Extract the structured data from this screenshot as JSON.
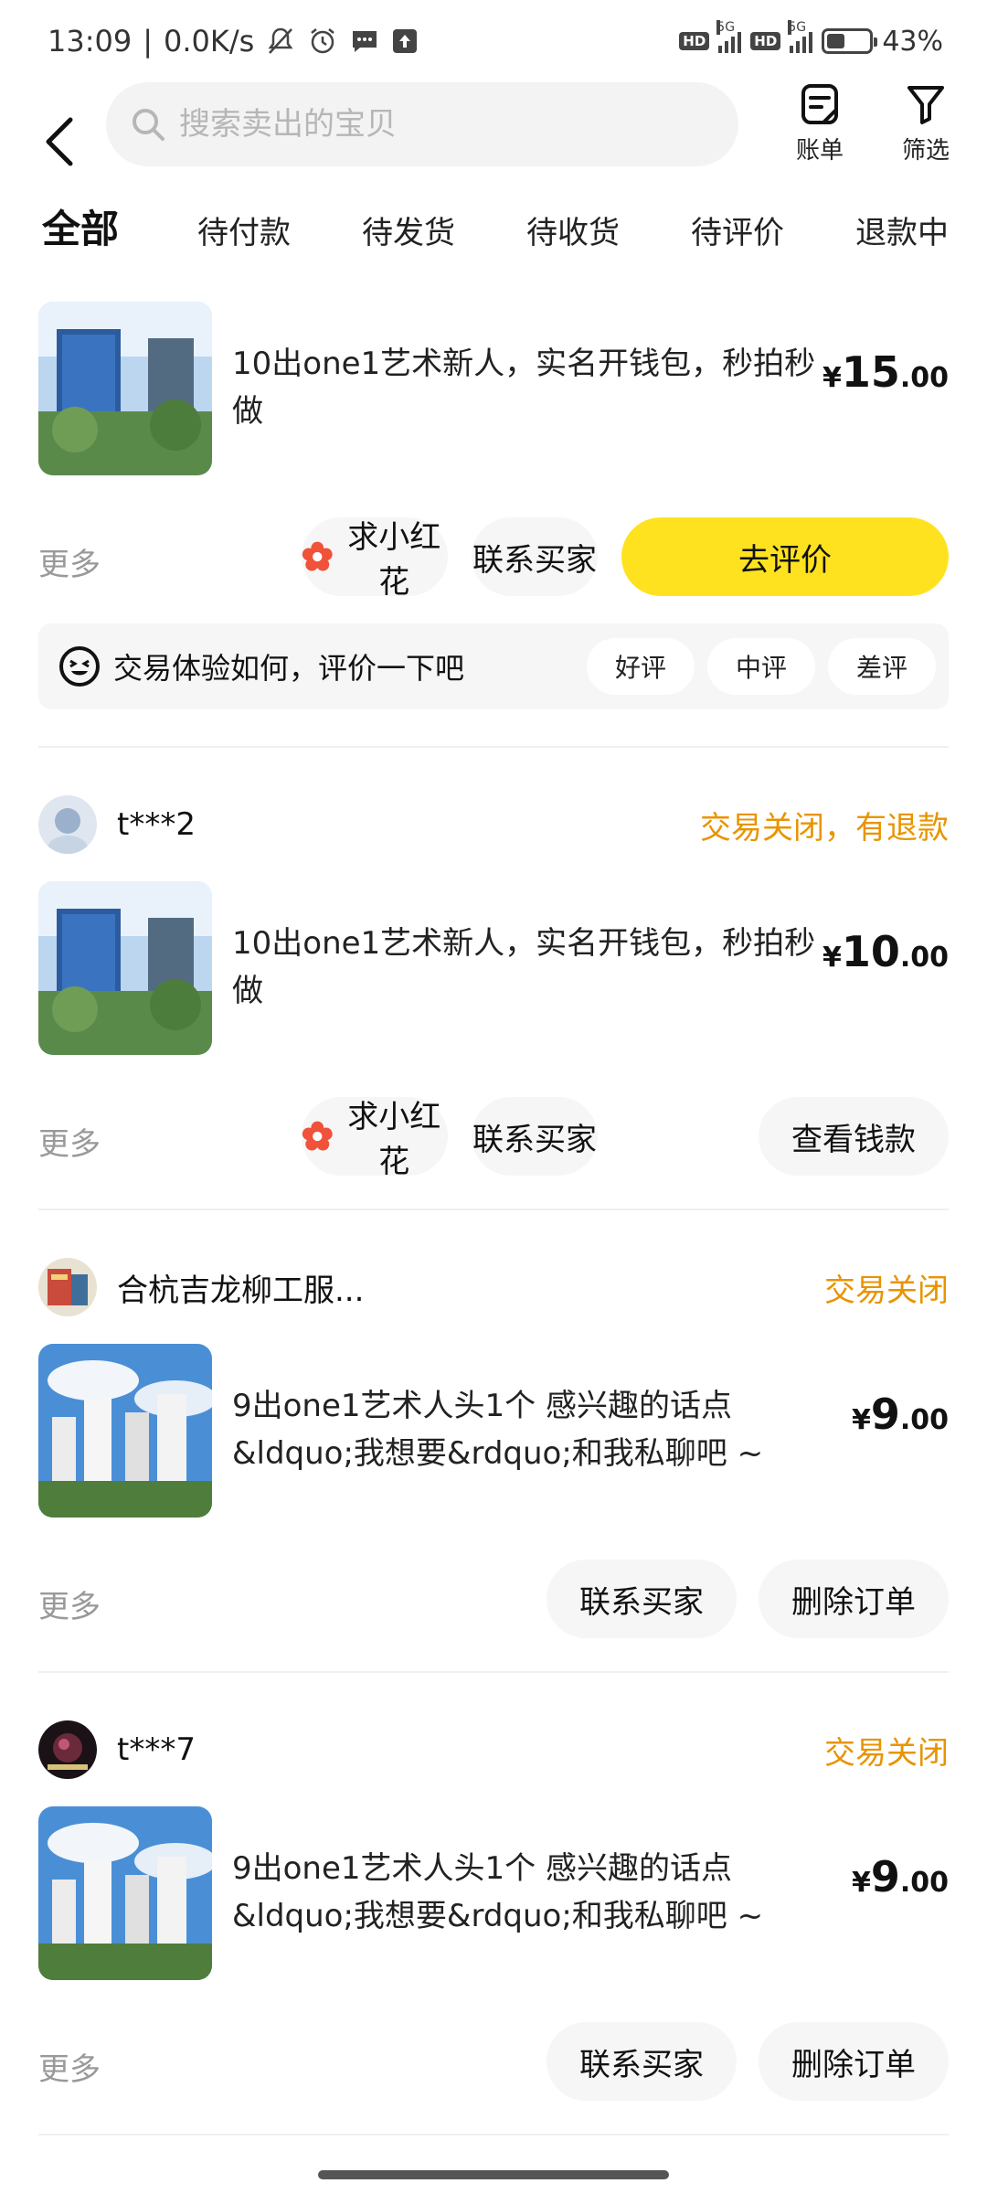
{
  "status_bar": {
    "time": "13:09",
    "network_speed": "0.0K/s",
    "hd1": "HD",
    "hd2": "HD",
    "net1": "5G",
    "net2": "5G",
    "battery_percent": "43%",
    "battery_level": 0.43,
    "icons": [
      "mute-icon",
      "alarm-icon",
      "message-icon",
      "upload-icon"
    ]
  },
  "header": {
    "search_placeholder": "搜索卖出的宝贝",
    "bill_label": "账单",
    "filter_label": "筛选"
  },
  "tabs": [
    {
      "label": "全部",
      "active": true
    },
    {
      "label": "待付款",
      "active": false
    },
    {
      "label": "待发货",
      "active": false
    },
    {
      "label": "待收货",
      "active": false
    },
    {
      "label": "待评价",
      "active": false
    },
    {
      "label": "退款中",
      "active": false
    }
  ],
  "orders": [
    {
      "seller": "",
      "status": "",
      "title": "10出one1艺术新人，实名开钱包，秒拍秒做",
      "price": {
        "currency": "¥",
        "integer": "15",
        "decimal": ".00"
      },
      "more": "更多",
      "actions": [
        "求小红花",
        "联系买家",
        "去评价"
      ],
      "review": {
        "prompt": "交易体验如何，评价一下吧",
        "options": [
          "好评",
          "中评",
          "差评"
        ]
      }
    },
    {
      "seller": "t***2",
      "status": "交易关闭，有退款",
      "title": "10出one1艺术新人，实名开钱包，秒拍秒做",
      "price": {
        "currency": "¥",
        "integer": "10",
        "decimal": ".00"
      },
      "more": "更多",
      "actions": [
        "求小红花",
        "联系买家",
        "查看钱款"
      ]
    },
    {
      "seller": "合杭吉龙柳工服...",
      "status": "交易关闭",
      "title": "9出one1艺术人头1个 感兴趣的话点&ldquo;我想要&rdquo;和我私聊吧 ~",
      "price": {
        "currency": "¥",
        "integer": "9",
        "decimal": ".00"
      },
      "more": "更多",
      "actions": [
        "联系买家",
        "删除订单"
      ]
    },
    {
      "seller": "t***7",
      "status": "交易关闭",
      "title": "9出one1艺术人头1个 感兴趣的话点&ldquo;我想要&rdquo;和我私聊吧 ~",
      "price": {
        "currency": "¥",
        "integer": "9",
        "decimal": ".00"
      },
      "more": "更多",
      "actions": [
        "联系买家",
        "删除订单"
      ]
    }
  ],
  "colors": {
    "accent_yellow": "#ffe21f",
    "status_orange": "#e89400",
    "flower_red": "#f0523a"
  }
}
